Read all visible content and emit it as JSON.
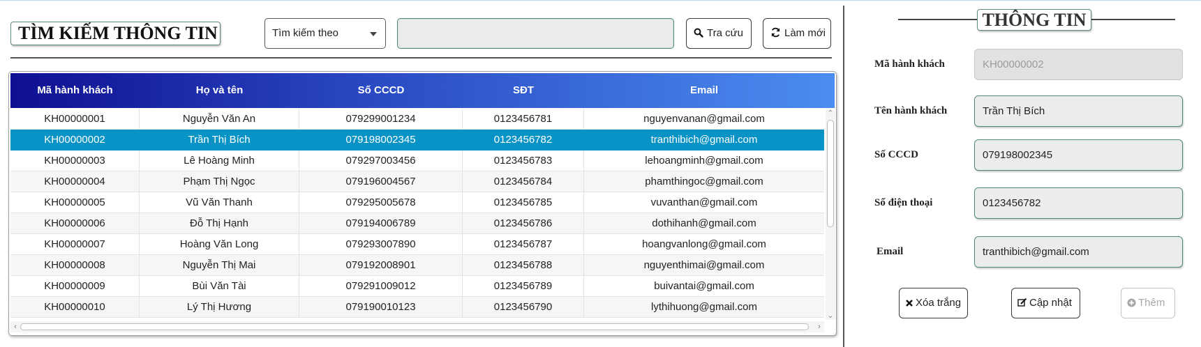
{
  "search_bar": {
    "title": "TÌM KIẾM THÔNG TIN",
    "filter_select": "Tìm kiếm theo",
    "search_value": "",
    "search_button": "Tra cứu",
    "refresh_button": "Làm mới",
    "search_icon": "magnifier-icon",
    "refresh_icon": "refresh-icon"
  },
  "table": {
    "columns": [
      "Mã hành khách",
      "Họ và tên",
      "Số CCCD",
      "SĐT",
      "Email"
    ],
    "rows": [
      [
        "KH00000001",
        "Nguyễn Văn An",
        "079299001234",
        "0123456781",
        "nguyenvanan@gmail.com"
      ],
      [
        "KH00000002",
        "Trần Thị Bích",
        "079198002345",
        "0123456782",
        "tranthibich@gmail.com"
      ],
      [
        "KH00000003",
        "Lê Hoàng Minh",
        "079297003456",
        "0123456783",
        "lehoangminh@gmail.com"
      ],
      [
        "KH00000004",
        "Phạm Thị Ngọc",
        "079196004567",
        "0123456784",
        "phamthingoc@gmail.com"
      ],
      [
        "KH00000005",
        "Vũ Văn Thanh",
        "079295005678",
        "0123456785",
        "vuvanthan@gmail.com"
      ],
      [
        "KH00000006",
        "Đỗ Thị Hạnh",
        "079194006789",
        "0123456786",
        "dothihanh@gmail.com"
      ],
      [
        "KH00000007",
        "Hoàng Văn Long",
        "079293007890",
        "0123456787",
        "hoangvanlong@gmail.com"
      ],
      [
        "KH00000008",
        "Nguyễn Thị Mai",
        "079192008901",
        "0123456788",
        "nguyenthimai@gmail.com"
      ],
      [
        "KH00000009",
        "Bùi Văn Tài",
        "079291009012",
        "0123456789",
        "buivantai@gmail.com"
      ],
      [
        "KH00000010",
        "Lý Thị Hương",
        "079190010123",
        "0123456790",
        "lythihuong@gmail.com"
      ]
    ],
    "selected_row_index": 1
  },
  "info_panel": {
    "title": "THÔNG TIN",
    "fields": [
      {
        "label": "Mã hành khách",
        "value": "KH00000002",
        "disabled": true
      },
      {
        "label": "Tên hành khách",
        "value": "Trần Thị Bích",
        "disabled": false
      },
      {
        "label": "Số CCCD",
        "value": "079198002345",
        "disabled": false
      },
      {
        "label": "Số điện thoại",
        "value": "0123456782",
        "disabled": false
      },
      {
        "label": "Email",
        "value": "tranthibich@gmail.com",
        "disabled": false
      }
    ],
    "buttons": {
      "clear": "Xóa trắng",
      "update": "Cập nhật",
      "add": "Thêm"
    }
  },
  "colors": {
    "header_gradient_start": "#0f0f93",
    "header_gradient_end": "#4b8df0",
    "selected_row": "#0893c6",
    "field_border": "#4f8a6f"
  }
}
